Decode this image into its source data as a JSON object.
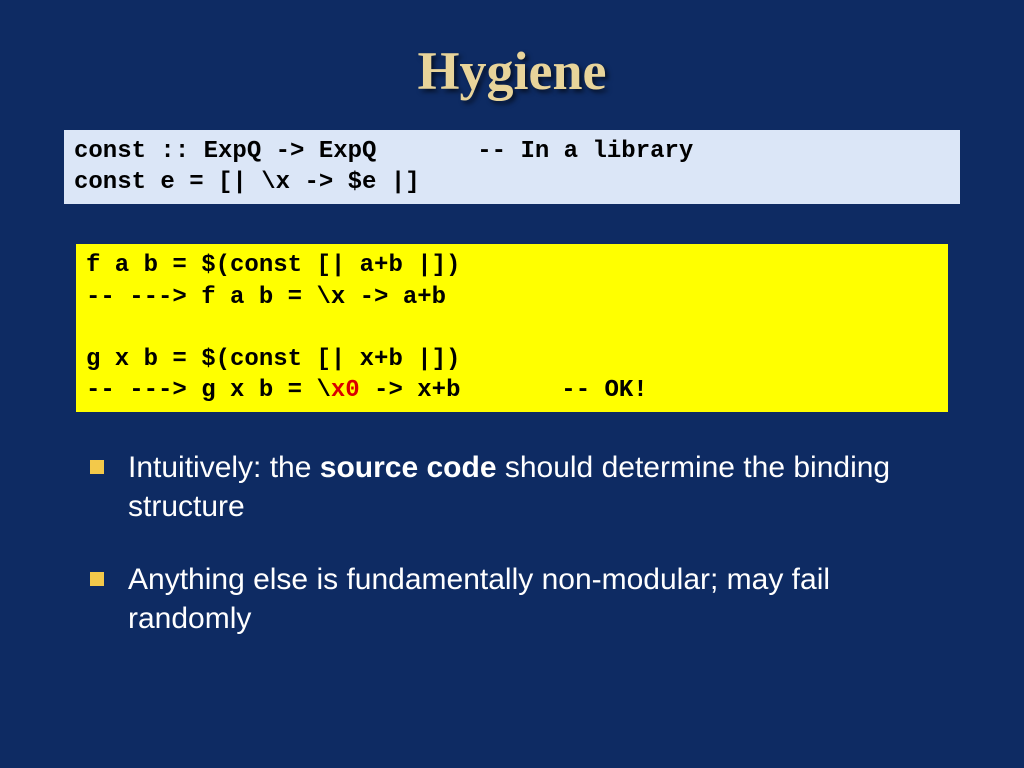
{
  "title": "Hygiene",
  "code_light": "const :: ExpQ -> ExpQ       -- In a library\nconst e = [| \\x -> $e |]",
  "code_yellow": {
    "line1": "f a b = $(const [| a+b |])",
    "line2": "-- ---> f a b = \\x -> a+b",
    "blank": " ",
    "line3": "g x b = $(const [| x+b |])",
    "line4a": "-- ---> g x b = \\",
    "line4_hl": "x0",
    "line4b": " -> x+b       -- OK!"
  },
  "bullets": {
    "b1_pre": "Intuitively: the ",
    "b1_bold": "source code",
    "b1_post": " should determine the binding structure",
    "b2": "Anything else is fundamentally non-modular; may fail randomly"
  }
}
